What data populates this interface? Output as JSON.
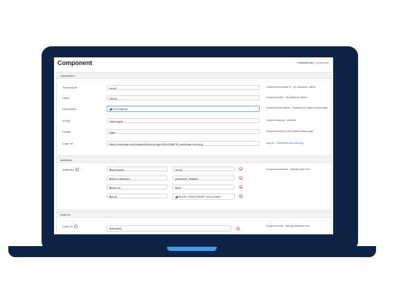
{
  "page": {
    "title": "Component"
  },
  "breadcrumb": {
    "link": "Components",
    "sep": "/",
    "current": "Component"
  },
  "component": {
    "section": "Component",
    "rows": [
      {
        "label": "Technical ID",
        "value": "neo4j",
        "help": "Component technical ID - my_awesome_starter"
      },
      {
        "label": "Label",
        "value": "Neo4j",
        "help": "Component label - My Awesome Starter"
      },
      {
        "label": "Description",
        "value": "Neo4j Graphql",
        "help": "Component description - Displayed on System design page"
      },
      {
        "label": "Group",
        "value": "data-mgmt",
        "help": "Component group - backend"
      },
      {
        "label": "Family",
        "value": "Data",
        "help": "Component family in the System design page"
      },
      {
        "label": "Logo Url",
        "value": "https://seeklogo.com/images/N/neo4j-logo-61611986F5C-seeklogo.com.png",
        "help_prefix": "Logo url - ",
        "help_link": "kubernetes-icon-color.svg"
      }
    ]
  },
  "attributes": {
    "section": "Attributes",
    "label": "Attributes",
    "help_prefix": "Component attributes - Manage them ",
    "help_link": "here",
    "items": [
      {
        "name": "Namespace",
        "value": "neo4j"
      },
      {
        "name": "Admin password",
        "value": "password_default1"
      },
      {
        "name": "Initdb On",
        "value": "false"
      },
      {
        "name": "init-db",
        "value": "CREATE CONSTRAINT ON (u:User)"
      }
    ]
  },
  "links": {
    "section": "Links To",
    "label": "Links To",
    "help_prefix": "Component links - Manage attributes ",
    "help_link": "here",
    "items": [
      {
        "name": "RabbitMQ"
      }
    ]
  }
}
